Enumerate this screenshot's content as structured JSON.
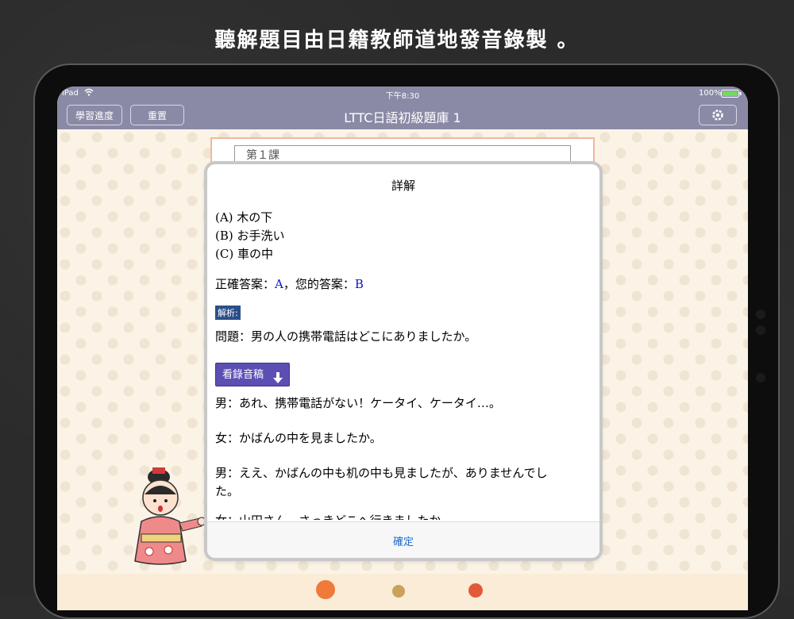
{
  "headline": "聽解題目由日籍教師道地發音錄製 。",
  "status": {
    "device": "iPad",
    "time": "下午8:30",
    "battery": "100%"
  },
  "nav": {
    "progress_label": "學習進度",
    "reset_label": "重置",
    "title": "LTTC日語初級題庫 1"
  },
  "behind": {
    "lesson": "第１課"
  },
  "dialog": {
    "title": "詳解",
    "options": [
      "(A) 木の下",
      "(B) お手洗い",
      "(C) 車の中"
    ],
    "answer_prefix": "正確答案：",
    "correct": "A",
    "mid": "，您的答案：",
    "yours": "B",
    "analysis_tag": "解析:",
    "question": "問題：男の人の携帯電話はどこにありましたか。",
    "transcript_button": "看錄音稿",
    "lines": [
      "男：あれ、携帯電話がない！ケータイ、ケータイ…。",
      "女：かばんの中を見ましたか。",
      "男：ええ、かばんの中も机の中も見ましたが、ありませんでし",
      "た。",
      "女：山田さん、さっきどこへ行きましたか。"
    ],
    "confirm": "確定"
  },
  "icons": {
    "wifi": "wifi-icon",
    "battery": "battery-icon",
    "gear": "gear-icon",
    "download": "arrow-down-icon"
  }
}
